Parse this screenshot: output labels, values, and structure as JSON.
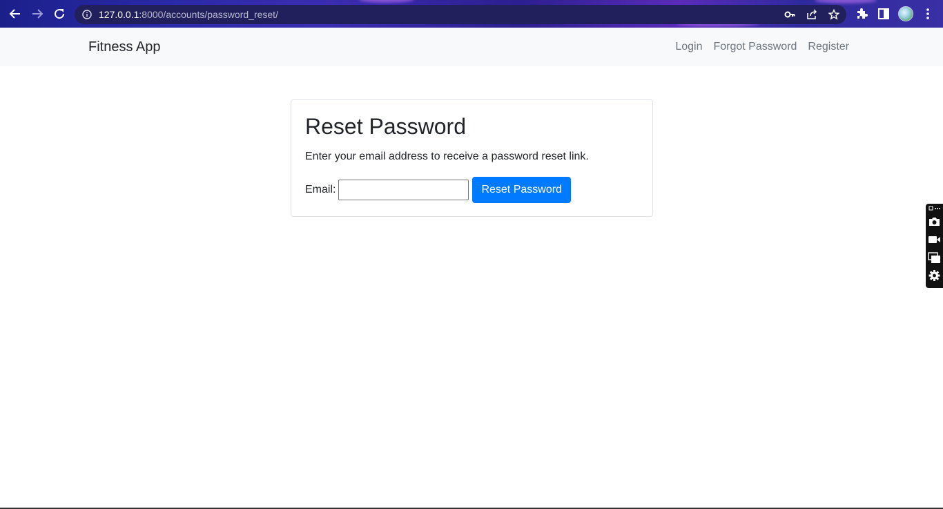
{
  "browser": {
    "url_host": "127.0.0.1",
    "url_rest": ":8000/accounts/password_reset/",
    "icons": {
      "back": "back-arrow-icon",
      "forward": "forward-arrow-icon",
      "reload": "reload-icon",
      "site_info": "info-icon",
      "password": "key-icon",
      "share": "share-icon",
      "bookmark": "star-icon",
      "extensions": "puzzle-icon",
      "side_panel": "side-panel-icon",
      "menu": "kebab-menu-icon"
    }
  },
  "navbar": {
    "brand": "Fitness App",
    "links": [
      {
        "label": "Login"
      },
      {
        "label": "Forgot Password"
      },
      {
        "label": "Register"
      }
    ]
  },
  "card": {
    "title": "Reset Password",
    "description": "Enter your email address to receive a password reset link.",
    "email_label": "Email:",
    "email_value": "",
    "submit_label": "Reset Password"
  },
  "colors": {
    "primary": "#007bff",
    "navbar_bg": "#f8f9fa",
    "text": "#212529",
    "muted": "#6c757d"
  },
  "side_toolbar": {
    "icons": [
      "camera-icon",
      "video-icon",
      "windows-icon",
      "gear-icon"
    ]
  }
}
